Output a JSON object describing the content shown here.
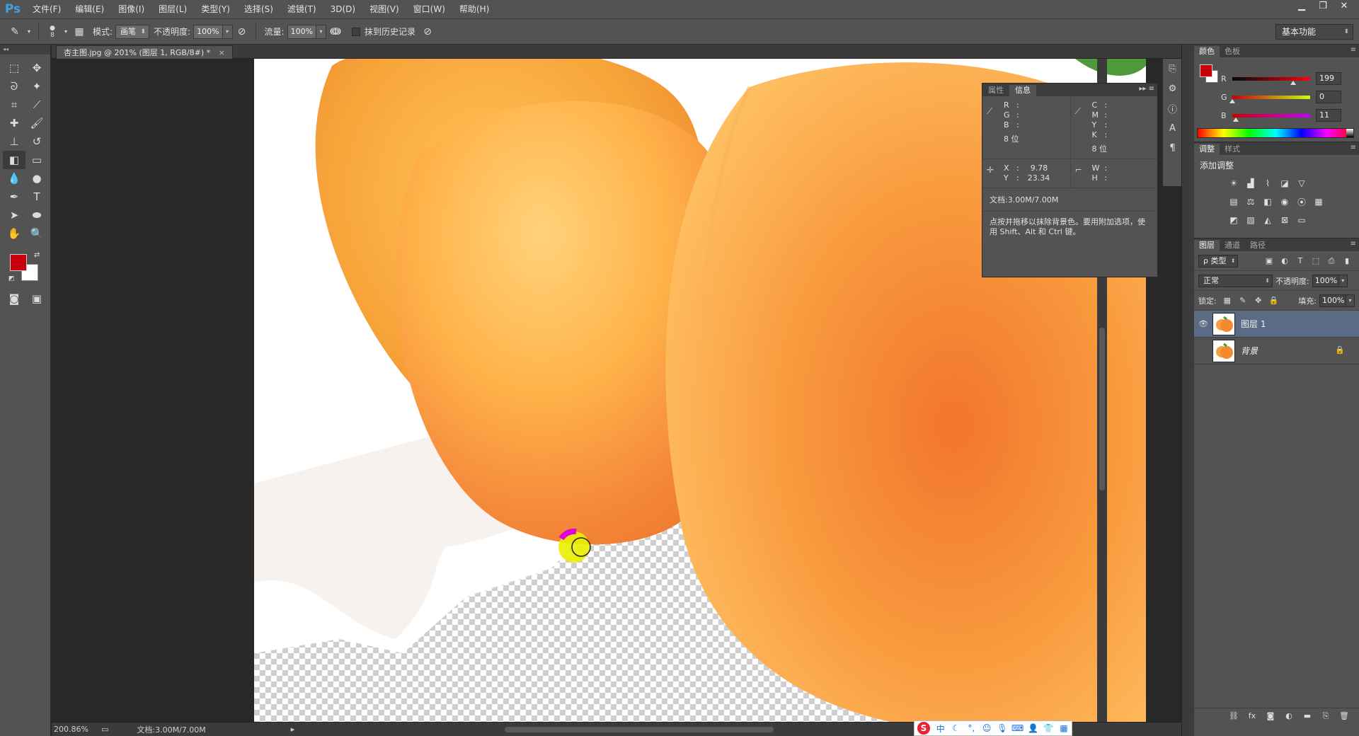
{
  "app": {
    "logo": "Ps"
  },
  "menu": [
    "文件(F)",
    "编辑(E)",
    "图像(I)",
    "图层(L)",
    "类型(Y)",
    "选择(S)",
    "滤镜(T)",
    "3D(D)",
    "视图(V)",
    "窗口(W)",
    "帮助(H)"
  ],
  "options": {
    "brush_size": "8",
    "mode_label": "模式:",
    "mode_value": "画笔",
    "opacity_label": "不透明度:",
    "opacity_value": "100%",
    "flow_label": "流量:",
    "flow_value": "100%",
    "history_label": "抹到历史记录",
    "workspace": "基本功能"
  },
  "document": {
    "tab_title": "杏主图.jpg @ 201% (图层 1, RGB/8#) *",
    "close": "×",
    "zoom": "200.86%",
    "doc_size": "文档:3.00M/7.00M"
  },
  "info_panel": {
    "tabs": [
      "属性",
      "信息"
    ],
    "active_tab": "信息",
    "rgb_keys": [
      "R",
      "G",
      "B"
    ],
    "cmyk_keys": [
      "C",
      "M",
      "Y",
      "K"
    ],
    "bits_left": "8 位",
    "bits_right": "8 位",
    "x_label": "X",
    "y_label": "Y",
    "x_value": "9.78",
    "y_value": "23.34",
    "w_label": "W",
    "h_label": "H",
    "doc": "文档:3.00M/7.00M",
    "hint": "点按并拖移以抹除背景色。要用附加选项，使用 Shift、Alt 和 Ctrl 键。"
  },
  "color_panel": {
    "tabs": [
      "颜色",
      "色板"
    ],
    "fg_color": "#c7000b",
    "r": {
      "label": "R",
      "value": "199"
    },
    "g": {
      "label": "G",
      "value": "0"
    },
    "b": {
      "label": "B",
      "value": "11"
    }
  },
  "adjust_panel": {
    "tabs": [
      "调整",
      "样式"
    ],
    "title": "添加调整"
  },
  "layers_panel": {
    "tabs": [
      "图层",
      "通道",
      "路径"
    ],
    "filter": "ρ 类型",
    "blend": "正常",
    "opacity_label": "不透明度:",
    "opacity": "100%",
    "lock_label": "锁定:",
    "fill_label": "填充:",
    "fill": "100%",
    "layers": [
      {
        "name": "图层 1",
        "selected": true
      },
      {
        "name": "背景",
        "selected": false
      }
    ]
  },
  "ime": {
    "lang": "中"
  }
}
